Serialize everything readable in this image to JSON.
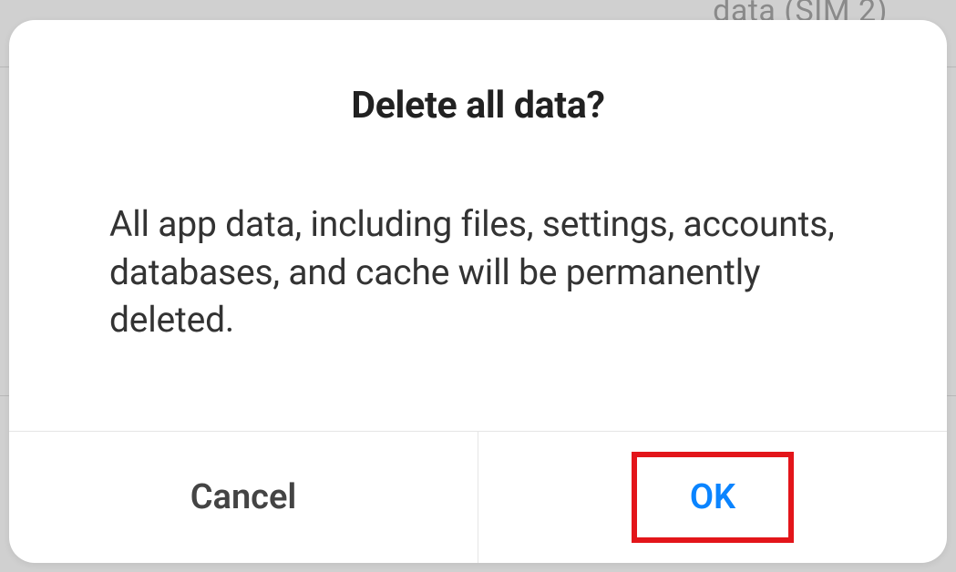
{
  "background": {
    "partial_text": "data (SIM 2)"
  },
  "dialog": {
    "title": "Delete all data?",
    "message": "All app data, including files, settings, accounts, databases, and cache will be permanently deleted.",
    "buttons": {
      "cancel_label": "Cancel",
      "ok_label": "OK"
    }
  }
}
